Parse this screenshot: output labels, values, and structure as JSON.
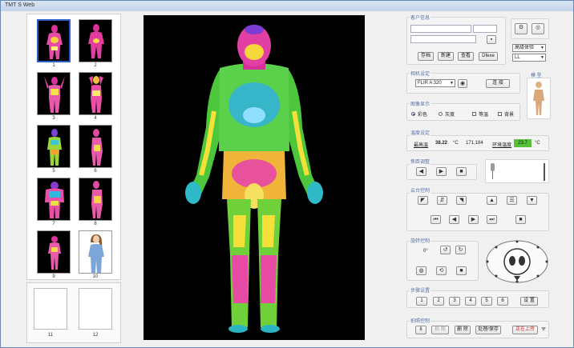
{
  "window": {
    "title": "TMT S Web"
  },
  "thumbnails": [
    {
      "label": "1"
    },
    {
      "label": "2"
    },
    {
      "label": "3"
    },
    {
      "label": "4"
    },
    {
      "label": "5"
    },
    {
      "label": "6"
    },
    {
      "label": "7"
    },
    {
      "label": "8"
    },
    {
      "label": "9"
    },
    {
      "label": "10"
    },
    {
      "label": "11"
    },
    {
      "label": "12"
    }
  ],
  "patient_group": {
    "label": "客户信息",
    "buttons": [
      "存档",
      "新建",
      "查看",
      "Dfexe"
    ],
    "select1": "高级体验",
    "select2": "LL"
  },
  "camera_group": {
    "label": "相机设定",
    "camera_value": "FLIR A 320",
    "connect_label": "连 接"
  },
  "model_label": "模 型",
  "display_group": {
    "label": "图像显示",
    "options": [
      "彩色",
      "灰度",
      "等温",
      "背景"
    ]
  },
  "temp_group": {
    "label": "温度设定",
    "max_label": "最高温",
    "max_value": "38.22",
    "unit1": "°C",
    "coords": "171,184",
    "env_label": "环境温度",
    "env_value": "23.7",
    "unit2": "°C"
  },
  "focus_group": {
    "label": "焦距调整"
  },
  "ptz_group": {
    "label": "云台控制"
  },
  "rotate_group": {
    "label": "旋转控制",
    "angle": "0°"
  },
  "steps_group": {
    "label": "步骤设置",
    "steps": [
      "1",
      "2",
      "3",
      "4",
      "5",
      "6"
    ],
    "set_label": "设 置"
  },
  "capture_group": {
    "label": "拍照控制",
    "buttons": [
      "II",
      "拍 照",
      "删 除",
      "处理/保存"
    ],
    "upload_label": "正在上传"
  },
  "colors": {
    "accent": "#2b5fc8",
    "group_label": "#5570a6",
    "env_temp_bg": "#55c039",
    "upload_text": "#c02020"
  }
}
